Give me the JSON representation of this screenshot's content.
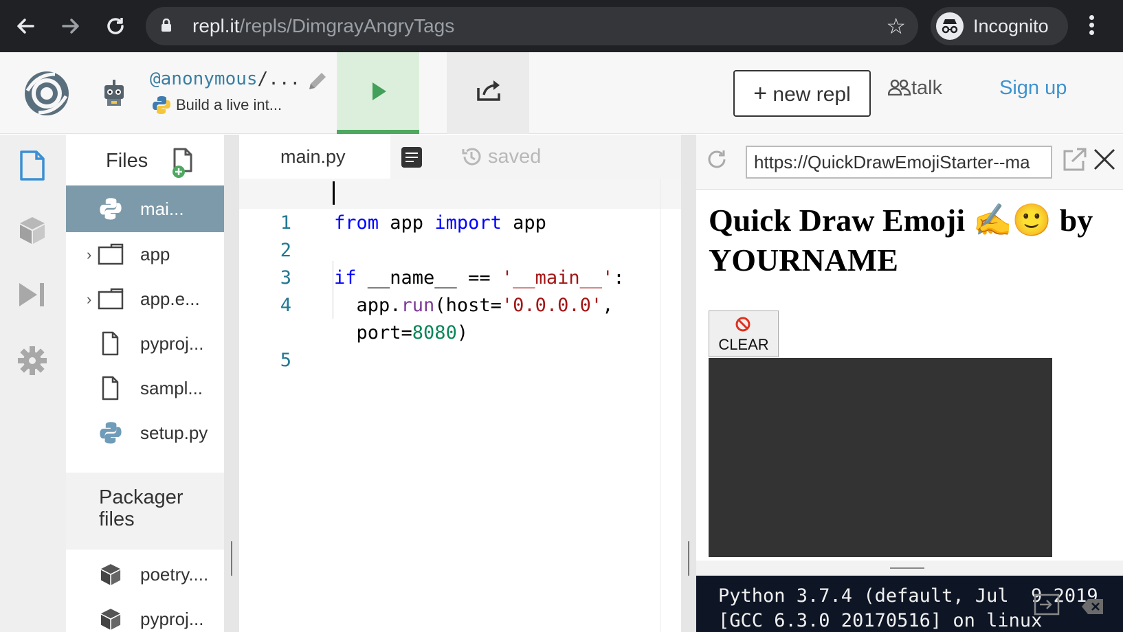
{
  "browser": {
    "url_domain": "repl.it",
    "url_path": "/repls/DimgrayAngryTags",
    "incognito_label": "Incognito"
  },
  "header": {
    "owner": "@anonymous",
    "owner_sep": "/...",
    "description": "Build a live int...",
    "new_repl_label": "new repl",
    "talk_label": "talk",
    "signup_label": "Sign up"
  },
  "files": {
    "title": "Files",
    "items": [
      {
        "name": "mai...",
        "type": "python",
        "active": true
      },
      {
        "name": "app",
        "type": "folder"
      },
      {
        "name": "app.e...",
        "type": "folder"
      },
      {
        "name": "pyproj...",
        "type": "file"
      },
      {
        "name": "sampl...",
        "type": "file"
      },
      {
        "name": "setup.py",
        "type": "python"
      }
    ],
    "packager_title": "Packager files",
    "packager_items": [
      {
        "name": "poetry....",
        "type": "package"
      },
      {
        "name": "pyproj...",
        "type": "package"
      }
    ]
  },
  "editor": {
    "tab_name": "main.py",
    "status": "saved",
    "line_numbers": [
      "1",
      "2",
      "3",
      "4",
      "",
      "5"
    ]
  },
  "preview": {
    "url": "https://QuickDrawEmojiStarter--ma",
    "title_line1": "Quick Draw Emoji ✍️🙂 by",
    "title_line2": "YOURNAME",
    "clear_label": "CLEAR"
  },
  "console": {
    "line1": "Python 3.7.4 (default, Jul  9 2019",
    "line2": "[GCC 6.3.0 20170516] on linux"
  },
  "colors": {
    "chrome_bg": "#202124",
    "run_green": "#43a05b",
    "active_file": "#7d9aaa",
    "link_blue": "#3e93cf",
    "console_bg": "#0e1525"
  }
}
